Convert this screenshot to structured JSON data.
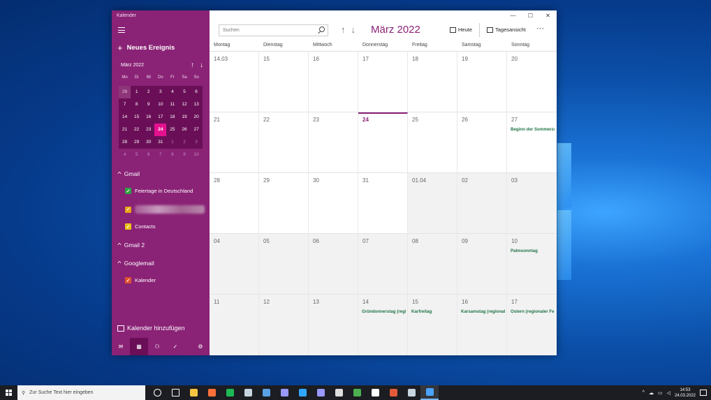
{
  "app": {
    "title": "Kalender",
    "new_event": "Neues Ereignis",
    "add_calendar": "Kalender hinzufügen"
  },
  "mini_calendar": {
    "title": "März 2022",
    "weekdays": [
      "Mo",
      "Di",
      "Mi",
      "Do",
      "Fr",
      "Sa",
      "So"
    ],
    "weeks": [
      [
        "28",
        "1",
        "2",
        "3",
        "4",
        "5",
        "6"
      ],
      [
        "7",
        "8",
        "9",
        "10",
        "11",
        "12",
        "13"
      ],
      [
        "14",
        "15",
        "16",
        "17",
        "18",
        "19",
        "20"
      ],
      [
        "21",
        "22",
        "23",
        "24",
        "25",
        "26",
        "27"
      ],
      [
        "28",
        "29",
        "30",
        "31",
        "1",
        "2",
        "3"
      ],
      [
        "4",
        "5",
        "6",
        "7",
        "8",
        "9",
        "10"
      ]
    ],
    "today": "24"
  },
  "accounts": [
    {
      "name": "Gmail",
      "calendars": [
        {
          "label": "Feiertage in Deutschland",
          "color": "#2ea043",
          "checked": true
        },
        {
          "label": "",
          "color": "#e8a317",
          "checked": true,
          "blurred": true
        },
        {
          "label": "Contacts",
          "color": "#e8c317",
          "checked": true
        }
      ]
    },
    {
      "name": "Gmail 2",
      "calendars": []
    },
    {
      "name": "Googlemail",
      "calendars": [
        {
          "label": "Kalender",
          "color": "#e0532f",
          "checked": true
        }
      ]
    }
  ],
  "toolbar": {
    "search_placeholder": "Suchen",
    "month_title": "März 2022",
    "today_label": "Heute",
    "view_label": "Tagesansicht",
    "more_label": "···"
  },
  "weekdays": [
    "Montag",
    "Dienstag",
    "Mittwoch",
    "Donnerstag",
    "Freitag",
    "Samstag",
    "Sonntag"
  ],
  "weeks": [
    [
      {
        "d": "14.03"
      },
      {
        "d": "15"
      },
      {
        "d": "16"
      },
      {
        "d": "17"
      },
      {
        "d": "18"
      },
      {
        "d": "19"
      },
      {
        "d": "20"
      }
    ],
    [
      {
        "d": "21"
      },
      {
        "d": "22"
      },
      {
        "d": "23"
      },
      {
        "d": "24",
        "today": true
      },
      {
        "d": "25"
      },
      {
        "d": "26"
      },
      {
        "d": "27",
        "ev": "Beginn der Sommerzeit"
      }
    ],
    [
      {
        "d": "28"
      },
      {
        "d": "29"
      },
      {
        "d": "30"
      },
      {
        "d": "31"
      },
      {
        "d": "01.04",
        "other": true
      },
      {
        "d": "02",
        "other": true
      },
      {
        "d": "03",
        "other": true
      }
    ],
    [
      {
        "d": "04",
        "other": true
      },
      {
        "d": "05",
        "other": true
      },
      {
        "d": "06",
        "other": true
      },
      {
        "d": "07",
        "other": true
      },
      {
        "d": "08",
        "other": true
      },
      {
        "d": "09",
        "other": true
      },
      {
        "d": "10",
        "other": true,
        "ev": "Palmsonntag"
      }
    ],
    [
      {
        "d": "11",
        "other": true
      },
      {
        "d": "12",
        "other": true
      },
      {
        "d": "13",
        "other": true
      },
      {
        "d": "14",
        "other": true,
        "ev": "Gründonnerstag (regional)"
      },
      {
        "d": "15",
        "other": true,
        "ev": "Karfreitag"
      },
      {
        "d": "16",
        "other": true,
        "ev": "Karsamstag (regional)"
      },
      {
        "d": "17",
        "other": true,
        "ev": "Ostern (regionaler Feiertag)"
      }
    ]
  ],
  "taskbar": {
    "search_placeholder": "Zur Suche Text hier eingeben",
    "time": "14:53",
    "date": "24.03.2022",
    "apps": [
      {
        "name": "task-view-icon",
        "color": "#ffffff"
      },
      {
        "name": "timeline-icon",
        "color": "#ffffff"
      },
      {
        "name": "file-explorer-icon",
        "color": "#f5c542"
      },
      {
        "name": "firefox-icon",
        "color": "#ff7139"
      },
      {
        "name": "spotify-icon",
        "color": "#1db954"
      },
      {
        "name": "steam-icon",
        "color": "#c7d5e0"
      },
      {
        "name": "droplet-app-icon",
        "color": "#5aa0e6"
      },
      {
        "name": "premiere-icon",
        "color": "#9999ff"
      },
      {
        "name": "photoshop-icon",
        "color": "#31a8ff"
      },
      {
        "name": "after-effects-icon",
        "color": "#9999ff"
      },
      {
        "name": "notepad-icon",
        "color": "#dddddd"
      },
      {
        "name": "chrome-icon",
        "color": "#4caf50"
      },
      {
        "name": "app-icon",
        "color": "#ffffff"
      },
      {
        "name": "game-icon",
        "color": "#e25b3a"
      },
      {
        "name": "steam-icon-2",
        "color": "#c7d5e0"
      },
      {
        "name": "calendar-app-icon",
        "color": "#4aa3ff"
      }
    ]
  }
}
